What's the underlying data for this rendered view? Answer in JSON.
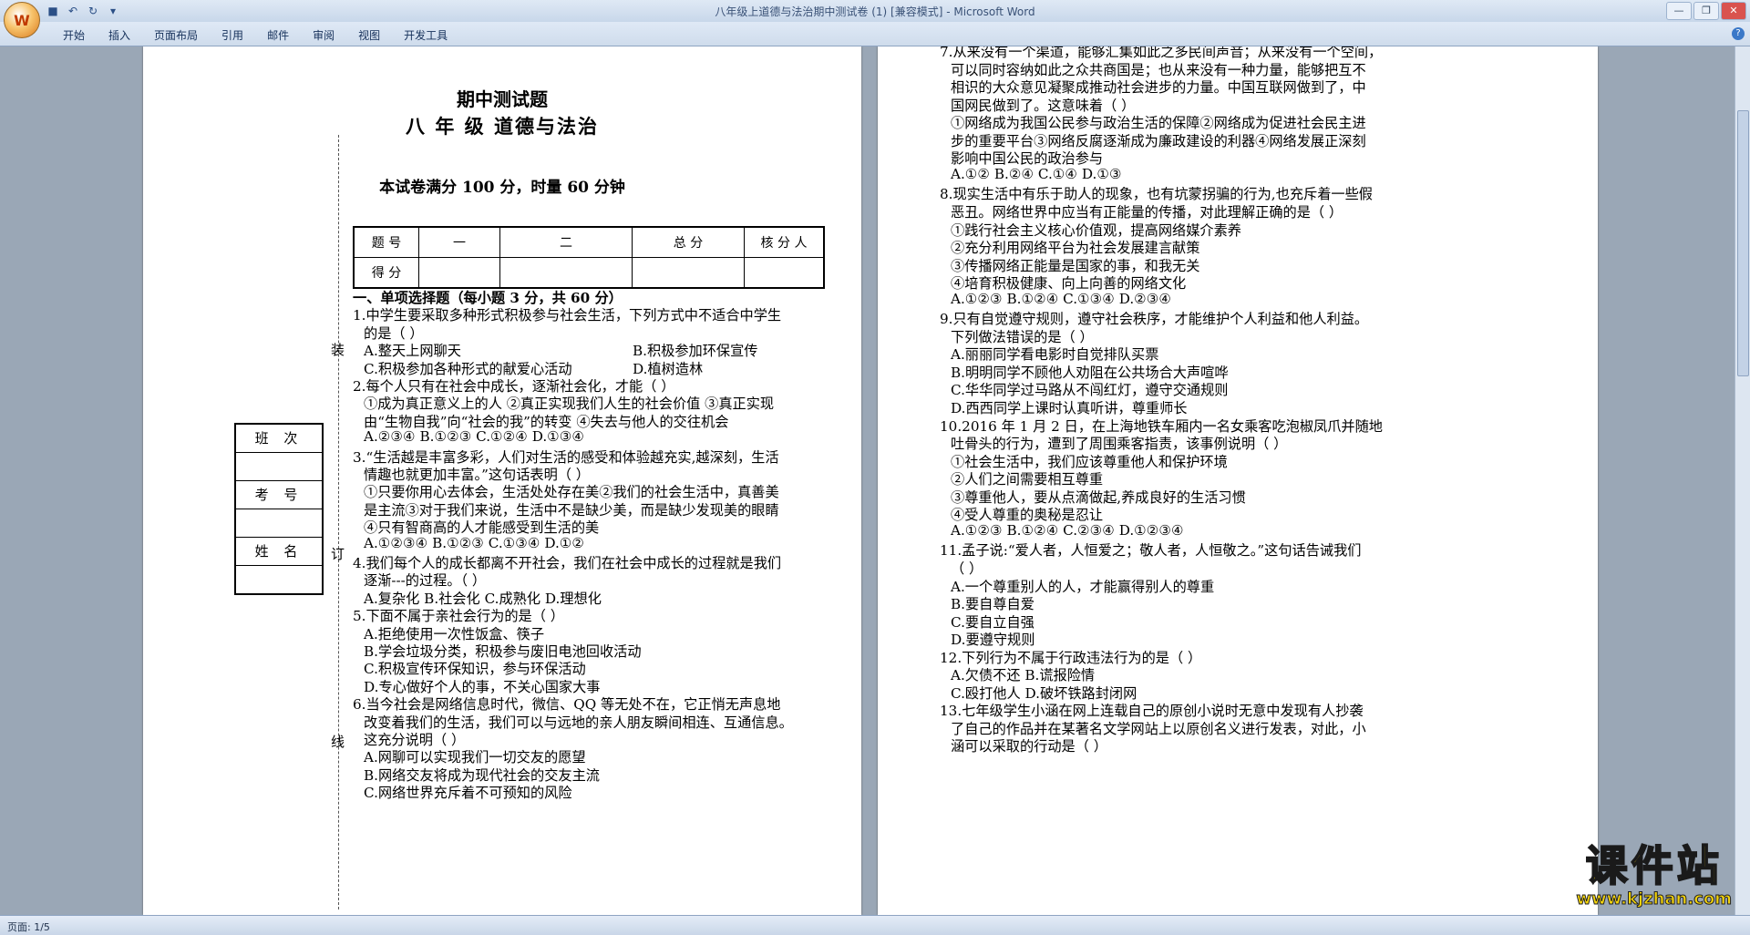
{
  "window": {
    "title": "八年级上道德与法治期中测试卷 (1) [兼容模式] - Microsoft Word",
    "office_button_icon": "office-logo",
    "qat": [
      "save-icon",
      "undo-icon",
      "redo-icon",
      "customize-icon"
    ]
  },
  "ribbon": {
    "tabs": [
      "开始",
      "插入",
      "页面布局",
      "引用",
      "邮件",
      "审阅",
      "视图",
      "开发工具"
    ]
  },
  "page1": {
    "title": "期中测试题",
    "subtitle": "八 年 级 道德与法治",
    "note": "本试卷满分 100 分，时量 60 分钟",
    "score_table": {
      "headers": [
        "题 号",
        "一",
        "二",
        "总 分",
        "核 分 人"
      ],
      "row_label": "得 分"
    },
    "side_labels": [
      "装",
      "订",
      "线"
    ],
    "side_box": [
      "班 次",
      "",
      "考 号",
      "",
      "姓 名",
      ""
    ],
    "lines": [
      "一、单项选择题（每小题 3 分，共 60 分）",
      "1.中学生要采取多种形式积极参与社会生活，下列方式中不适合中学生",
      "的是（ ）",
      "A.整天上网聊天",
      "B.积极参加环保宣传",
      "C.积极参加各种形式的献爱心活动",
      "D.植树造林",
      "2.每个人只有在社会中成长，逐渐社会化，才能（ ）",
      "①成为真正意义上的人 ②真正实现我们人生的社会价值 ③真正实现",
      "由“生物自我”向“社会的我”的转变 ④失去与他人的交往机会",
      "A.②③④ B.①②③ C.①②④ D.①③④",
      "3.“生活越是丰富多彩，人们对生活的感受和体验越充实,越深刻，生活",
      "情趣也就更加丰富。”这句话表明（ ）",
      "①只要你用心去体会，生活处处存在美②我们的社会生活中，真善美",
      "是主流③对于我们来说，生活中不是缺少美，而是缺少发现美的眼睛",
      "④只有智商高的人才能感受到生活的美",
      "A.①②③④ B.①②③ C.①③④ D.①②",
      "4.我们每个人的成长都离不开社会，我们在社会中成长的过程就是我们",
      "逐渐---的过程。（ ）",
      "A.复杂化 B.社会化 C.成熟化 D.理想化",
      "5.下面不属于亲社会行为的是（ ）",
      "A.拒绝使用一次性饭盒、筷子",
      "B.学会垃圾分类，积极参与废旧电池回收活动",
      "C.积极宣传环保知识，参与环保活动",
      "D.专心做好个人的事，不关心国家大事",
      "6.当今社会是网络信息时代，微信、QQ 等无处不在，它正悄无声息地",
      "改变着我们的生活，我们可以与远地的亲人朋友瞬间相连、互通信息。",
      "这充分说明（ ）",
      "A.网聊可以实现我们一切交友的愿望",
      "B.网络交友将成为现代社会的交友主流",
      "C.网络世界充斥着不可预知的风险"
    ]
  },
  "page2": {
    "lines": [
      "7.从来没有一个渠道，能够汇集如此之多民间声音；从来没有一个空间，",
      "可以同时容纳如此之众共商国是；也从来没有一种力量，能够把互不",
      "相识的大众意见凝聚成推动社会进步的力量。中国互联网做到了，中",
      "国网民做到了。这意味着（ ）",
      "①网络成为我国公民参与政治生活的保障②网络成为促进社会民主进",
      "步的重要平台③网络反腐逐渐成为廉政建设的利器④网络发展正深刻",
      "影响中国公民的政治参与",
      "A.①② B.②④ C.①④ D.①③",
      "8.现实生活中有乐于助人的现象，也有坑蒙拐骗的行为,也充斥着一些假",
      "恶丑。网络世界中应当有正能量的传播，对此理解正确的是（ ）",
      "①践行社会主义核心价值观，提高网络媒介素养",
      "②充分利用网络平台为社会发展建言献策",
      "③传播网络正能量是国家的事，和我无关",
      "④培育积极健康、向上向善的网络文化",
      "A.①②③ B.①②④ C.①③④ D.②③④",
      "9.只有自觉遵守规则，遵守社会秩序，才能维护个人利益和他人利益。",
      "下列做法错误的是（ ）",
      "A.丽丽同学看电影时自觉排队买票",
      "B.明明同学不顾他人劝阻在公共场合大声喧哗",
      "C.华华同学过马路从不闯红灯，遵守交通规则",
      "D.西西同学上课时认真听讲，尊重师长",
      "10.2016 年 1 月 2 日，在上海地铁车厢内一名女乘客吃泡椒凤爪并随地",
      "吐骨头的行为，遭到了周围乘客指责，该事例说明（ ）",
      "①社会生活中，我们应该尊重他人和保护环境",
      "②人们之间需要相互尊重",
      "③尊重他人，要从点滴做起,养成良好的生活习惯",
      "④受人尊重的奥秘是忍让",
      "A.①②③ B.①②④ C.②③④ D.①②③④",
      "11.孟子说:“爱人者，人恒爱之；敬人者，人恒敬之。”这句话告诫我们",
      "（ ）",
      "A.一个尊重别人的人，才能赢得别人的尊重",
      "B.要自尊自爱",
      "C.要自立自强",
      "D.要遵守规则",
      "12.下列行为不属于行政违法行为的是（ ）",
      "A.欠债不还 B.谎报险情",
      "C.殴打他人 D.破坏铁路封闭网",
      "13.七年级学生小涵在网上连载自己的原创小说时无意中发现有人抄袭",
      "了自己的作品并在某著名文学网站上以原创名义进行发表，对此，小",
      "涵可以采取的行动是（ ）"
    ]
  },
  "status": {
    "page": "页面: 1/5"
  },
  "watermark": {
    "brand": "课件站",
    "url": "www.kjzhan.com"
  }
}
